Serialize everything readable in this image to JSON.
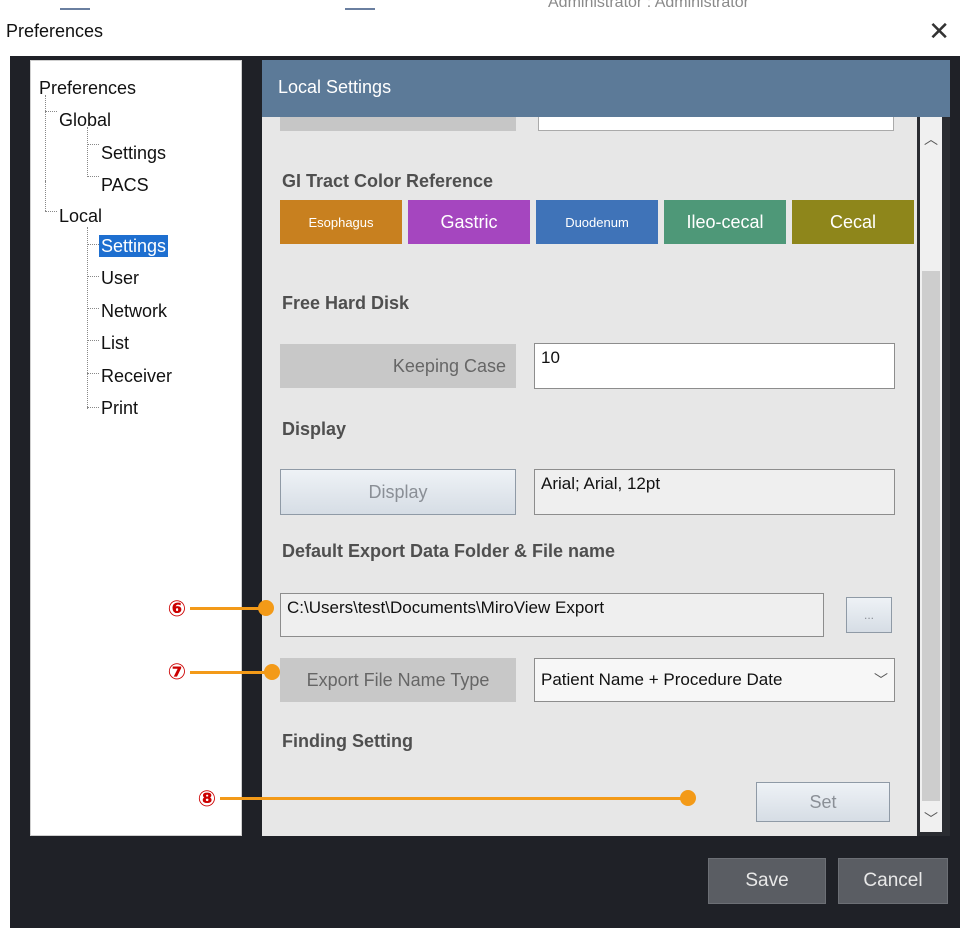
{
  "background_app": {
    "text": "Administrator : Administrator"
  },
  "dialog": {
    "title": "Preferences",
    "close_icon": "close-icon"
  },
  "tree": {
    "root": "Preferences",
    "global": "Global",
    "global_settings": "Settings",
    "global_pacs": "PACS",
    "local": "Local",
    "local_settings": "Settings",
    "local_user": "User",
    "local_network": "Network",
    "local_list": "List",
    "local_receiver": "Receiver",
    "local_print": "Print",
    "selected": "local_settings"
  },
  "panel": {
    "title": "Local Settings"
  },
  "gi_tract": {
    "heading": "GI Tract Color Reference",
    "buttons": [
      {
        "label": "Esophagus",
        "color": "#c8801f"
      },
      {
        "label": "Gastric",
        "color": "#a546bf"
      },
      {
        "label": "Duodenum",
        "color": "#3f73b8"
      },
      {
        "label": "Ileo-cecal",
        "color": "#4e9878"
      },
      {
        "label": "Cecal",
        "color": "#8e861b"
      }
    ]
  },
  "free_hard_disk": {
    "heading": "Free Hard Disk",
    "label": "Keeping Case",
    "value": "10"
  },
  "display": {
    "heading": "Display",
    "button_label": "Display",
    "font_value": "Arial; Arial, 12pt"
  },
  "export": {
    "heading": "Default Export Data Folder & File name",
    "folder_path": "C:\\Users\\test\\Documents\\MiroView Export",
    "browse_label": "...",
    "name_type_label": "Export File Name Type",
    "name_type_value": "Patient Name + Procedure Date"
  },
  "finding": {
    "heading": "Finding Setting",
    "set_label": "Set"
  },
  "footer": {
    "save_label": "Save",
    "cancel_label": "Cancel"
  },
  "callouts": {
    "c6": "⑥",
    "c7": "⑦",
    "c8": "⑧",
    "color": "#f39a18"
  },
  "scroll": {
    "up_icon": "chevron-up-icon",
    "down_icon": "chevron-down-icon"
  }
}
